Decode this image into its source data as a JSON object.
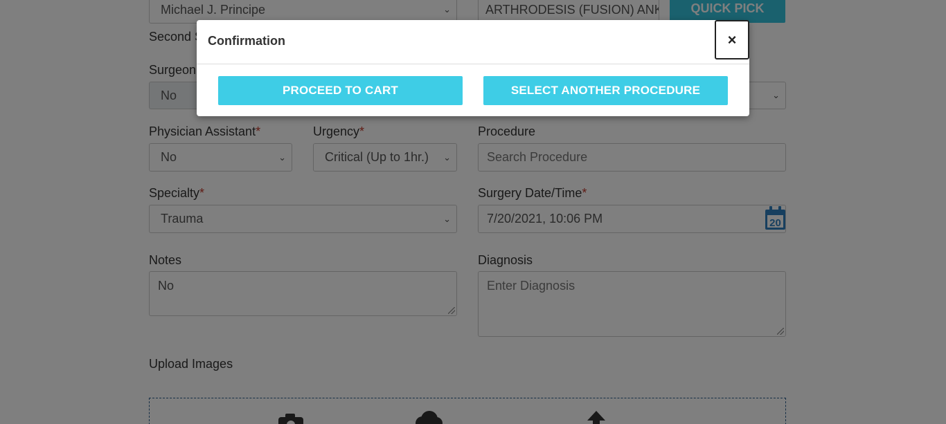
{
  "form": {
    "surgeon_select_value": "Michael J. Principe",
    "procedure_top_value": "ARTHRODESIS (FUSION) ANKL",
    "quick_pick_label": "QUICK PICK",
    "second_label_partial": "Second S",
    "surgeon_label_partial": "Surgeon",
    "surgeon_row_value": "No",
    "physician_assistant": {
      "label": "Physician Assistant",
      "required_mark": "*",
      "value": "No"
    },
    "urgency": {
      "label": "Urgency",
      "required_mark": "*",
      "value": "Critical (Up to 1hr.)"
    },
    "procedure": {
      "label": "Procedure",
      "placeholder": "Search Procedure"
    },
    "specialty": {
      "label": "Specialty",
      "required_mark": "*",
      "value": "Trauma"
    },
    "surgery_datetime": {
      "label": "Surgery Date/Time",
      "required_mark": "*",
      "value": "7/20/2021, 10:06 PM",
      "calendar_day": "20"
    },
    "notes": {
      "label": "Notes",
      "value": "No"
    },
    "diagnosis": {
      "label": "Diagnosis",
      "placeholder": "Enter Diagnosis"
    },
    "upload": {
      "label": "Upload Images"
    }
  },
  "modal": {
    "title": "Confirmation",
    "close_label": "×",
    "proceed_label": "PROCEED TO CART",
    "select_another_label": "SELECT ANOTHER PROCEDURE"
  },
  "colors": {
    "accent": "#3ecde6",
    "overlay": "rgba(0,0,0,0.5)",
    "required": "#c0392b",
    "calendar": "#2f7fbf"
  }
}
